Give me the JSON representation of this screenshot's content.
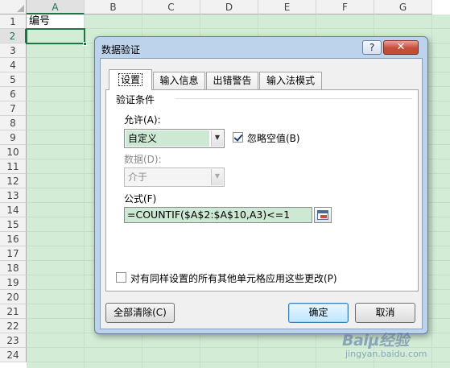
{
  "sheet": {
    "columns": [
      "A",
      "B",
      "C",
      "D",
      "E",
      "F",
      "G"
    ],
    "rows": [
      "1",
      "2",
      "3",
      "4",
      "5",
      "6",
      "7",
      "8",
      "9",
      "10",
      "11",
      "12",
      "13",
      "14",
      "15",
      "16",
      "17",
      "18",
      "19",
      "20",
      "21",
      "22",
      "23",
      "24"
    ],
    "cell_a1": "编号"
  },
  "dialog": {
    "title": "数据验证",
    "help_button": "?",
    "close_button": "✕",
    "tabs": [
      {
        "label": "设置",
        "active": true
      },
      {
        "label": "输入信息",
        "active": false
      },
      {
        "label": "出错警告",
        "active": false
      },
      {
        "label": "输入法模式",
        "active": false
      }
    ],
    "group_title": "验证条件",
    "allow_label": "允许(A):",
    "allow_value": "自定义",
    "ignore_blank_label": "忽略空值(B)",
    "ignore_blank_checked": true,
    "data_label": "数据(D):",
    "data_value": "介于",
    "formula_label": "公式(F)",
    "formula_value": "=COUNTIF($A$2:$A$10,A3)<=1",
    "apply_all_label": "对有同样设置的所有其他单元格应用这些更改(P)",
    "apply_all_checked": false,
    "clear_all_button": "全部清除(C)",
    "ok_button": "确定",
    "cancel_button": "取消"
  },
  "watermark": {
    "main": "Baiµ经验",
    "sub": "jingyan.baidu.com"
  }
}
